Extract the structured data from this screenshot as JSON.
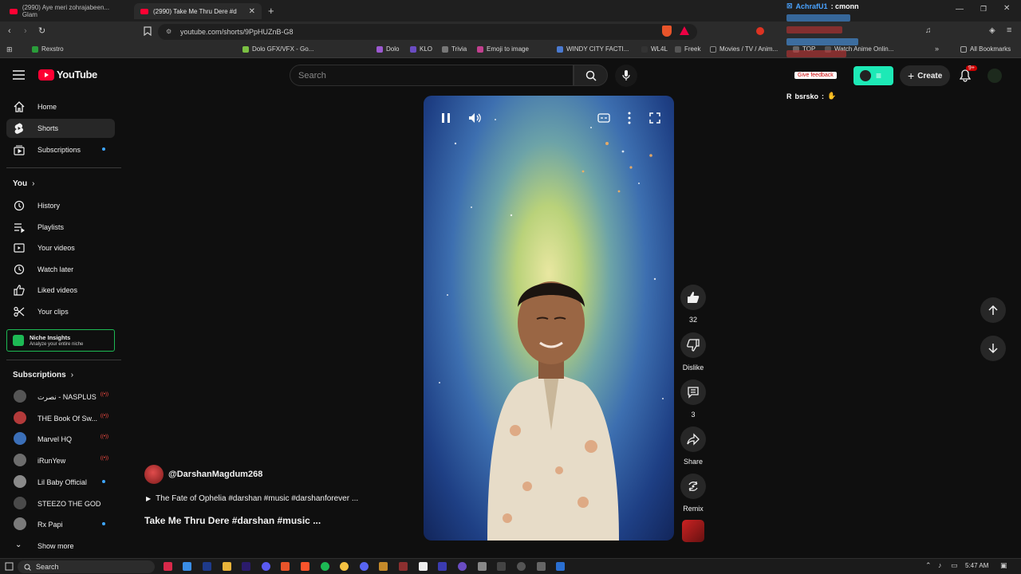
{
  "browser": {
    "tabs": [
      {
        "label": "(2990) Aye meri zohrajabeen... Glam"
      },
      {
        "label": "(2990) Take Me Thru Dere #d"
      }
    ],
    "url": "youtube.com/shorts/9PpHUZnB-G8",
    "bookmarks": [
      "Rexstro",
      "Dolo GFX/VFX - Go...",
      "Dolo",
      "KLO",
      "Trivia",
      "Emoji to image",
      "WINDY CITY FACTI...",
      "WL4L",
      "Freek",
      "Movies / TV / Anim...",
      "TOP",
      "Watch Anime Onlin..."
    ],
    "all_bookmarks": "All Bookmarks"
  },
  "header": {
    "logo_text": "YouTube",
    "search_placeholder": "Search",
    "create_label": "Create",
    "notif_count": "9+"
  },
  "sidebar": {
    "main": [
      {
        "label": "Home",
        "icon": "home-icon"
      },
      {
        "label": "Shorts",
        "icon": "shorts-icon"
      },
      {
        "label": "Subscriptions",
        "icon": "subscriptions-icon"
      }
    ],
    "you_header": "You",
    "you_items": [
      {
        "label": "History",
        "icon": "history-icon"
      },
      {
        "label": "Playlists",
        "icon": "playlists-icon"
      },
      {
        "label": "Your videos",
        "icon": "your-videos-icon"
      },
      {
        "label": "Watch later",
        "icon": "watch-later-icon"
      },
      {
        "label": "Liked videos",
        "icon": "liked-videos-icon"
      },
      {
        "label": "Your clips",
        "icon": "clips-icon"
      }
    ],
    "niche": {
      "title": "Niche Insights",
      "subtitle": "Analyze your entire niche"
    },
    "subs_header": "Subscriptions",
    "subscriptions": [
      {
        "label": "نصرت - NASPLUS",
        "status": "live",
        "color": "#555555"
      },
      {
        "label": "THE Book Of Sw...",
        "status": "live",
        "color": "#b33a3a"
      },
      {
        "label": "Marvel HQ",
        "status": "live",
        "color": "#3b6fb8"
      },
      {
        "label": "iRunYew",
        "status": "live",
        "color": "#6d6d6d"
      },
      {
        "label": "Lil Baby Official",
        "status": "dot",
        "color": "#8a8a8a"
      },
      {
        "label": "STEEZO THE GOD",
        "status": "",
        "color": "#4a4a4a"
      },
      {
        "label": "Rx Papi",
        "status": "dot",
        "color": "#7a7a7a"
      }
    ],
    "show_more": "Show more"
  },
  "short": {
    "channel": "@DarshanMagdum268",
    "sound": "The Fate of Ophelia #darshan #music #darshanforever ...",
    "title": "Take Me Thru Dere #darshan #music ...",
    "likes": "32",
    "dislike_label": "Dislike",
    "comments": "3",
    "share_label": "Share",
    "remix_label": "Remix"
  },
  "chat": [
    {
      "user": "AchrafU1",
      "msg": ": cmonn",
      "color": "#4aa3ff"
    },
    {
      "user": "bsrsko",
      "msg": ": ",
      "color": "#ffffff"
    }
  ],
  "overlay": {
    "give_feedback": "Give feedback"
  },
  "taskbar": {
    "search": "Search",
    "time": "5:47 AM"
  }
}
